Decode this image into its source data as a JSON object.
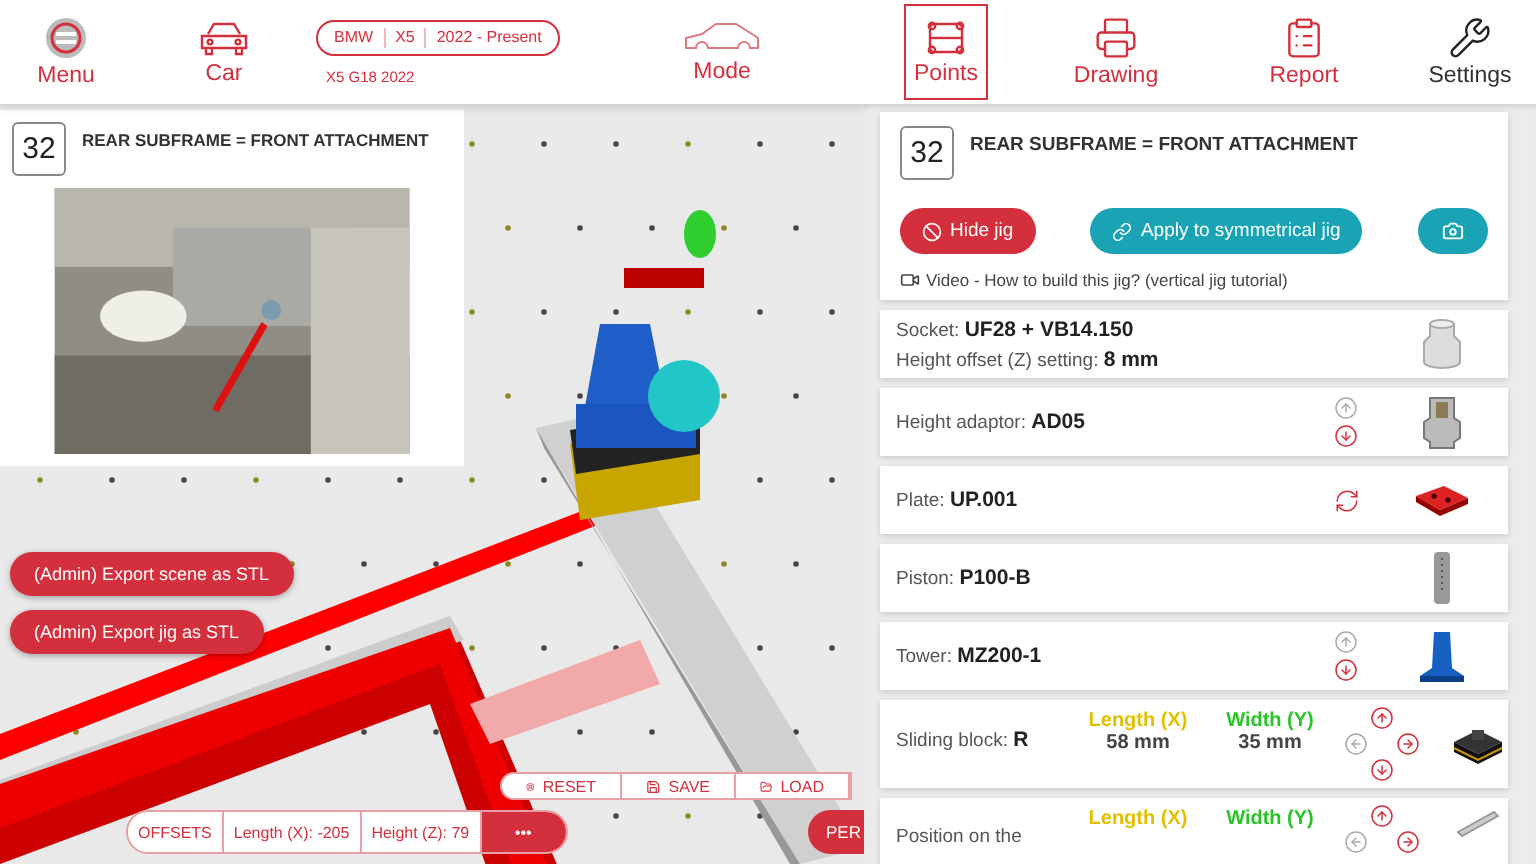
{
  "top_nav": {
    "left_items": [
      {
        "kind": "menu",
        "label": "Menu"
      },
      {
        "kind": "car",
        "label": "Car"
      }
    ],
    "vehicle": {
      "make": "BMW",
      "model": "X5",
      "years": "2022 - Present",
      "code": "X5 G18 2022"
    },
    "mode": {
      "label": "Mode"
    },
    "tabs": [
      {
        "kind": "points",
        "label": "Points",
        "selected": true
      },
      {
        "kind": "drawing",
        "label": "Drawing",
        "selected": false
      },
      {
        "kind": "report",
        "label": "Report",
        "selected": false
      },
      {
        "kind": "settings",
        "label": "Settings",
        "selected": false
      }
    ]
  },
  "scene": {
    "kind": "picture",
    "info_card": {
      "number": "32",
      "title": "REAR SUBFRAME = FRONT ATTACHMENT"
    },
    "admin_buttons": [
      "(Admin) Export scene as STL",
      "(Admin) Export jig as STL"
    ],
    "view_toolbar": [
      {
        "kind": "reset",
        "label": "RESET"
      },
      {
        "kind": "save",
        "label": "SAVE"
      },
      {
        "kind": "load",
        "label": "LOAD"
      }
    ],
    "offsets": {
      "label": "OFFSETS",
      "length": "Length (X): -205",
      "height": "Height (Z): 79",
      "more": "•••"
    },
    "perspective_button": "PER"
  },
  "panel": {
    "jig_card": {
      "number": "32",
      "title": "REAR SUBFRAME = FRONT ATTACHMENT",
      "buttons": [
        {
          "kind": "hide",
          "label": "Hide jig"
        },
        {
          "kind": "apply",
          "label": "Apply to symmetrical jig"
        },
        {
          "kind": "camera"
        }
      ],
      "video_link": "Video - How to build this jig? (vertical jig tutorial)"
    },
    "parts": [
      {
        "kind": "socket",
        "label": "Socket:",
        "value": "UF28 + VB14.150",
        "sub_label": "Height offset (Z) setting:",
        "sub_value": "8 mm"
      },
      {
        "kind": "adaptor",
        "label": "Height adaptor:",
        "value": "AD05",
        "arrows": [
          {
            "kind": "up",
            "enabled": false
          },
          {
            "kind": "down",
            "enabled": true
          }
        ]
      },
      {
        "kind": "plate",
        "label": "Plate:",
        "value": "UP.001",
        "rotate": true
      },
      {
        "kind": "piston",
        "label": "Piston:",
        "value": "P100-B"
      },
      {
        "kind": "tower",
        "label": "Tower:",
        "value": "MZ200-1",
        "arrows": [
          {
            "kind": "up",
            "enabled": false
          },
          {
            "kind": "down",
            "enabled": true
          }
        ]
      },
      {
        "kind": "block",
        "label": "Sliding block:",
        "value": "R",
        "length_label": "Length (X)",
        "width_label": "Width (Y)",
        "length": "58 mm",
        "width": "35 mm",
        "arrows": [
          {
            "kind": "up",
            "enabled": true
          },
          {
            "kind": "left",
            "enabled": false
          },
          {
            "kind": "right",
            "enabled": true
          },
          {
            "kind": "down",
            "enabled": true
          }
        ]
      },
      {
        "kind": "rail",
        "label": "Position on the",
        "length_label": "Length (X)",
        "width_label": "Width (Y)",
        "arrows": [
          {
            "kind": "up",
            "enabled": true
          },
          {
            "kind": "left",
            "enabled": false
          },
          {
            "kind": "right",
            "enabled": true
          }
        ]
      }
    ]
  }
}
